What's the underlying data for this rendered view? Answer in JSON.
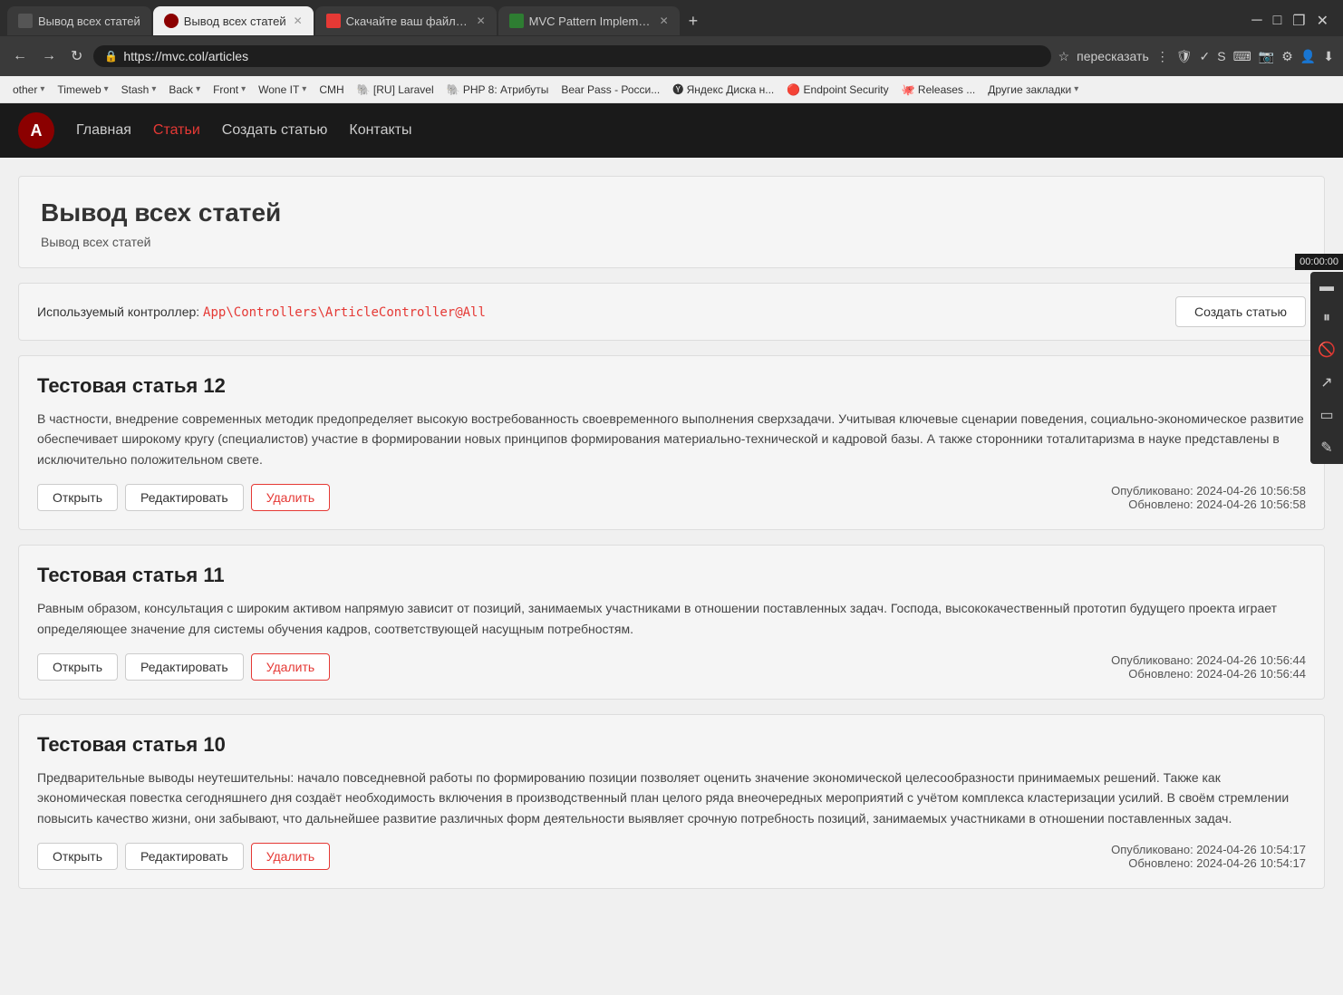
{
  "browser": {
    "tabs": [
      {
        "id": "tab1",
        "title": "Вывод всех статей",
        "active": false,
        "favicon_color": "#555"
      },
      {
        "id": "tab2",
        "title": "Вывод всех статей",
        "active": true,
        "favicon_color": "#8B0000"
      },
      {
        "id": "tab3",
        "title": "Скачайте ваш файл — Co...",
        "active": false,
        "favicon_color": "#e53935"
      },
      {
        "id": "tab4",
        "title": "MVC Pattern Implementati...",
        "active": false,
        "favicon_color": "#2e7d32"
      }
    ],
    "address": "https://mvc.col/articles",
    "bookmarks": [
      {
        "label": "other",
        "has_arrow": true
      },
      {
        "label": "Timeweb",
        "has_arrow": true
      },
      {
        "label": "Stash",
        "has_arrow": true
      },
      {
        "label": "Back",
        "has_arrow": true
      },
      {
        "label": "Front",
        "has_arrow": true
      },
      {
        "label": "Wone IT",
        "has_arrow": true
      },
      {
        "label": "CMH",
        "has_arrow": false
      },
      {
        "label": "[RU] Laravel",
        "has_arrow": false
      },
      {
        "label": "PHP 8: Атрибуты",
        "has_arrow": false
      },
      {
        "label": "Bear Pass - Росси...",
        "has_arrow": false
      },
      {
        "label": "Яндекс Диска н...",
        "has_arrow": false
      },
      {
        "label": "Endpoint Security",
        "has_arrow": false
      },
      {
        "label": "Releases ...",
        "has_arrow": false
      },
      {
        "label": "Другие закладки",
        "has_arrow": true
      }
    ]
  },
  "navbar": {
    "logo_text": "A",
    "links": [
      {
        "label": "Главная",
        "active": false
      },
      {
        "label": "Статьи",
        "active": true
      },
      {
        "label": "Создать статью",
        "active": false
      },
      {
        "label": "Контакты",
        "active": false
      }
    ]
  },
  "page": {
    "title": "Вывод всех статей",
    "subtitle": "Вывод всех статей",
    "controller_label": "Используемый контроллер:",
    "controller_path": "App\\Controllers\\ArticleController@All",
    "create_button": "Создать статью"
  },
  "articles": [
    {
      "id": 12,
      "title": "Тестовая статья 12",
      "body": "В частности, внедрение современных методик предопределяет высокую востребованность своевременного выполнения сверхзадачи. Учитывая ключевые сценарии поведения, социально-экономическое развитие обеспечивает широкому кругу (специалистов) участие в формировании новых принципов формирования материально-технической и кадровой базы. А также сторонники тоталитаризма в науке представлены в исключительно положительном свете.",
      "published": "Опубликовано: 2024-04-26 10:56:58",
      "updated": "Обновлено: 2024-04-26 10:56:58",
      "btn_open": "Открыть",
      "btn_edit": "Редактировать",
      "btn_delete": "Удалить"
    },
    {
      "id": 11,
      "title": "Тестовая статья 11",
      "body": "Равным образом, консультация с широким активом напрямую зависит от позиций, занимаемых участниками в отношении поставленных задач. Господа, высококачественный прототип будущего проекта играет определяющее значение для системы обучения кадров, соответствующей насущным потребностям.",
      "published": "Опубликовано: 2024-04-26 10:56:44",
      "updated": "Обновлено: 2024-04-26 10:56:44",
      "btn_open": "Открыть",
      "btn_edit": "Редактировать",
      "btn_delete": "Удалить"
    },
    {
      "id": 10,
      "title": "Тестовая статья 10",
      "body": "Предварительные выводы неутешительны: начало повседневной работы по формированию позиции позволяет оценить значение экономической целесообразности принимаемых решений. Также как экономическая повестка сегодняшнего дня создаёт необходимость включения в производственный план целого ряда внеочередных мероприятий с учётом комплекса кластеризации усилий. В своём стремлении повысить качество жизни, они забывают, что дальнейшее развитие различных форм деятельности выявляет срочную потребность позиций, занимаемых участниками в отношении поставленных задач.",
      "published": "Опубликовано: 2024-04-26 10:54:17",
      "updated": "Обновлено: 2024-04-26 10:54:17",
      "btn_open": "Открыть",
      "btn_edit": "Редактировать",
      "btn_delete": "Удалить"
    }
  ],
  "side_panel": {
    "time": "00:00:00"
  }
}
